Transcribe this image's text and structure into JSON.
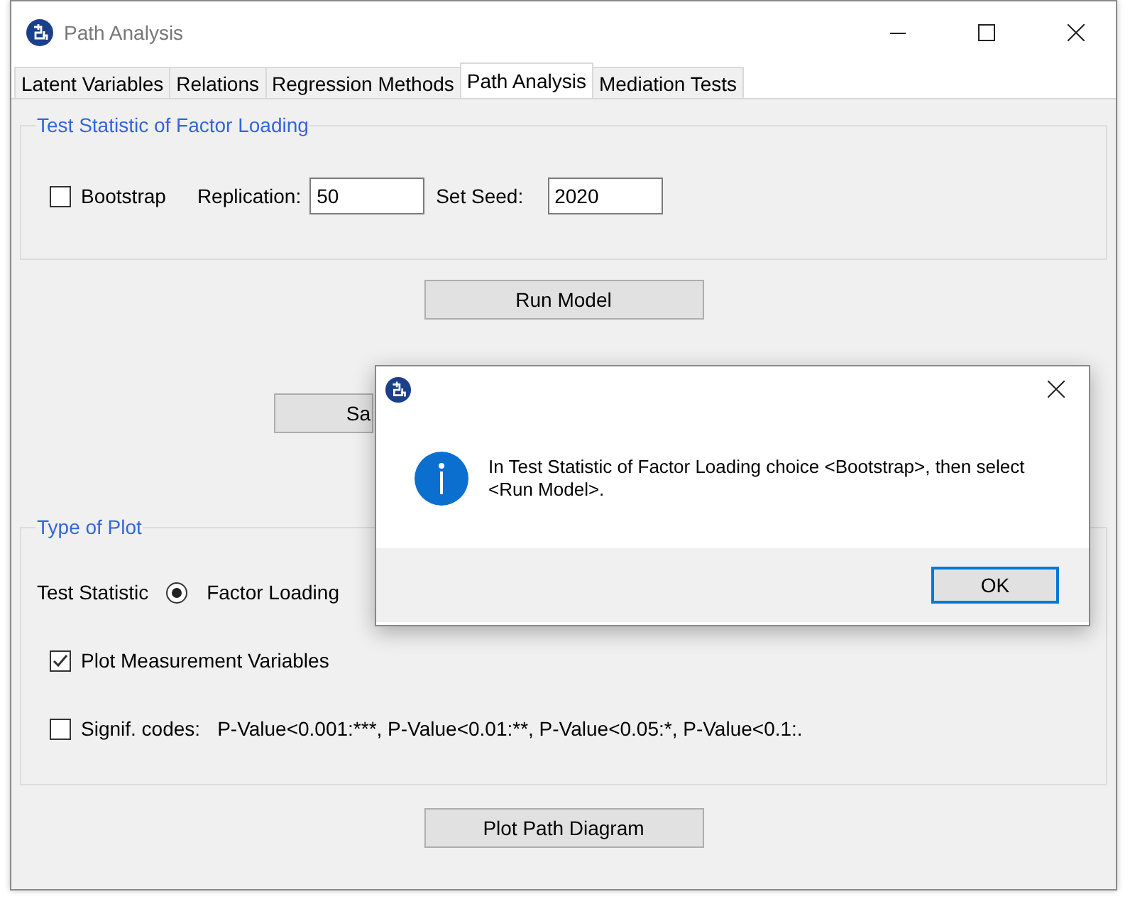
{
  "window": {
    "title": "Path Analysis"
  },
  "tabs": [
    {
      "label": "Latent Variables",
      "selected": false
    },
    {
      "label": "Relations",
      "selected": false
    },
    {
      "label": "Regression Methods",
      "selected": false
    },
    {
      "label": "Path Analysis",
      "selected": true
    },
    {
      "label": "Mediation Tests",
      "selected": false
    }
  ],
  "factor_loading_group": {
    "title": "Test Statistic of Factor Loading",
    "bootstrap": {
      "label": "Bootstrap",
      "checked": false
    },
    "replication": {
      "label": "Replication:",
      "value": "50"
    },
    "seed": {
      "label": "Set Seed:",
      "value": "2020"
    }
  },
  "run_model_button": "Run Model",
  "save_button": "Sa",
  "plot_type_group": {
    "title": "Type of Plot",
    "test_statistic_label": "Test Statistic",
    "radio": {
      "label": "Factor Loading",
      "selected": true
    },
    "plot_measurement": {
      "label": "Plot Measurement Variables",
      "checked": true
    },
    "signif_codes": {
      "label": "Signif. codes:",
      "checked": false,
      "note": "P-Value<0.001:***, P-Value<0.01:**, P-Value<0.05:*, P-Value<0.1:."
    }
  },
  "plot_button": "Plot Path Diagram",
  "dialog": {
    "message": "In Test Statistic of Factor Loading choice <Bootstrap>, then select <Run Model>.",
    "button": "OK"
  }
}
